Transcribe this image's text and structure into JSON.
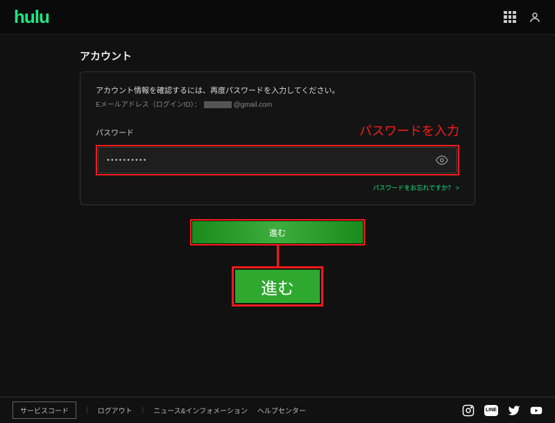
{
  "brand": "hulu",
  "page_title": "アカウント",
  "card": {
    "instruction": "アカウント情報を確認するには、再度パスワードを入力してください。",
    "email_label": "Eメールアドレス（ログインID）：",
    "email_suffix": "@gmail.com",
    "password_label": "パスワード",
    "password_value": "••••••••••",
    "forgot_link": "パスワードをお忘れですか？ >"
  },
  "annotation": {
    "password_hint": "パスワードを入力",
    "zoom_label": "進む"
  },
  "submit": {
    "label": "進む"
  },
  "footer": {
    "service_code": "サービスコード",
    "logout": "ログアウト",
    "news": "ニュース&インフォメーション",
    "help": "ヘルプセンター"
  }
}
